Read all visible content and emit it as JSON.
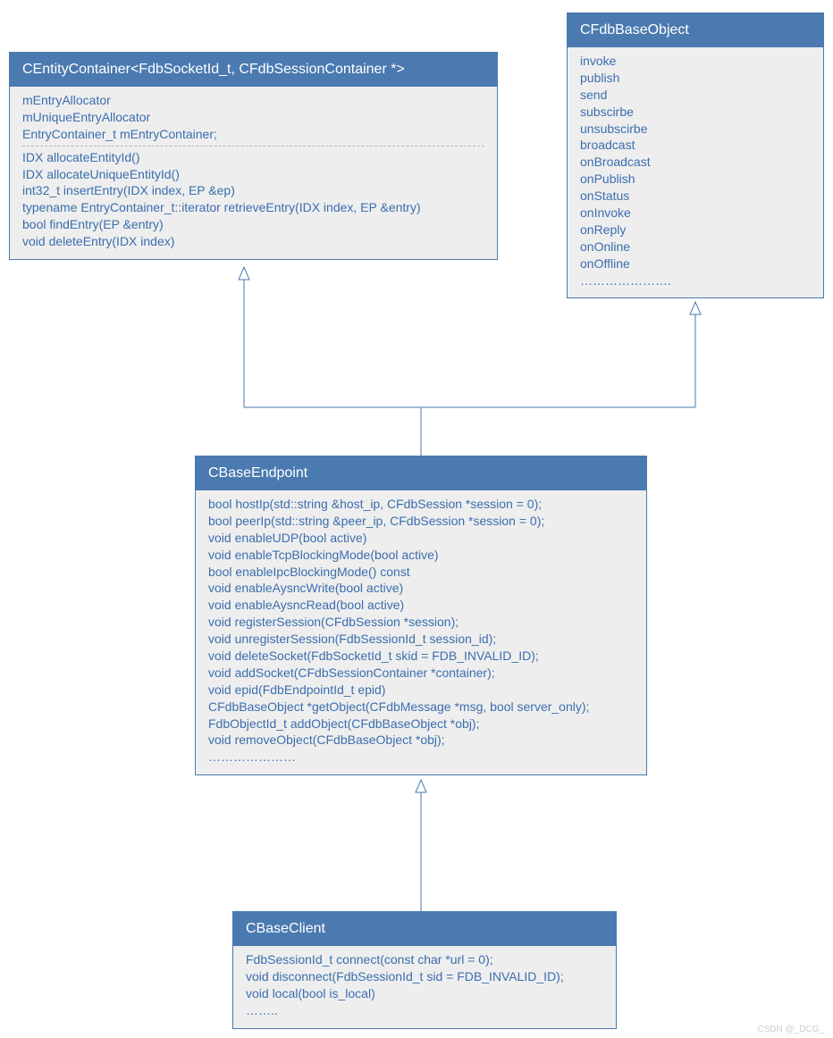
{
  "classes": {
    "entityContainer": {
      "title": "CEntityContainer<FdbSocketId_t, CFdbSessionContainer *>",
      "attrs": [
        "mEntryAllocator",
        "mUniqueEntryAllocator",
        "EntryContainer_t mEntryContainer;"
      ],
      "ops": [
        "IDX allocateEntityId()",
        "IDX allocateUniqueEntityId()",
        "int32_t insertEntry(IDX index, EP &ep)",
        "typename EntryContainer_t::iterator retrieveEntry(IDX index, EP &entry)",
        "bool findEntry(EP &entry)",
        "void deleteEntry(IDX index)"
      ]
    },
    "baseObject": {
      "title": "CFdbBaseObject",
      "ops": [
        "invoke",
        "publish",
        "send",
        "subscirbe",
        "unsubscirbe",
        "broadcast",
        "onBroadcast",
        "onPublish",
        "onStatus",
        "onInvoke",
        "onReply",
        "onOnline",
        "onOffline",
        "…………………."
      ]
    },
    "baseEndpoint": {
      "title": "CBaseEndpoint",
      "ops": [
        "bool hostIp(std::string &host_ip, CFdbSession *session = 0);",
        "bool peerIp(std::string &peer_ip, CFdbSession *session = 0);",
        "void enableUDP(bool active)",
        "void enableTcpBlockingMode(bool active)",
        "bool enableIpcBlockingMode() const",
        "void enableAysncWrite(bool active)",
        "void enableAysncRead(bool active)",
        "void registerSession(CFdbSession *session);",
        "void unregisterSession(FdbSessionId_t session_id);",
        "void deleteSocket(FdbSocketId_t skid = FDB_INVALID_ID);",
        "void addSocket(CFdbSessionContainer *container);",
        "void epid(FdbEndpointId_t epid)",
        "CFdbBaseObject *getObject(CFdbMessage *msg, bool server_only);",
        "FdbObjectId_t addObject(CFdbBaseObject *obj);",
        "void removeObject(CFdbBaseObject *obj);",
        "…………………"
      ]
    },
    "baseClient": {
      "title": "CBaseClient",
      "ops": [
        "FdbSessionId_t connect(const char *url = 0);",
        "void disconnect(FdbSessionId_t sid = FDB_INVALID_ID);",
        "void local(bool is_local)",
        "…….."
      ]
    }
  },
  "watermark": "CSDN @_DCG_"
}
